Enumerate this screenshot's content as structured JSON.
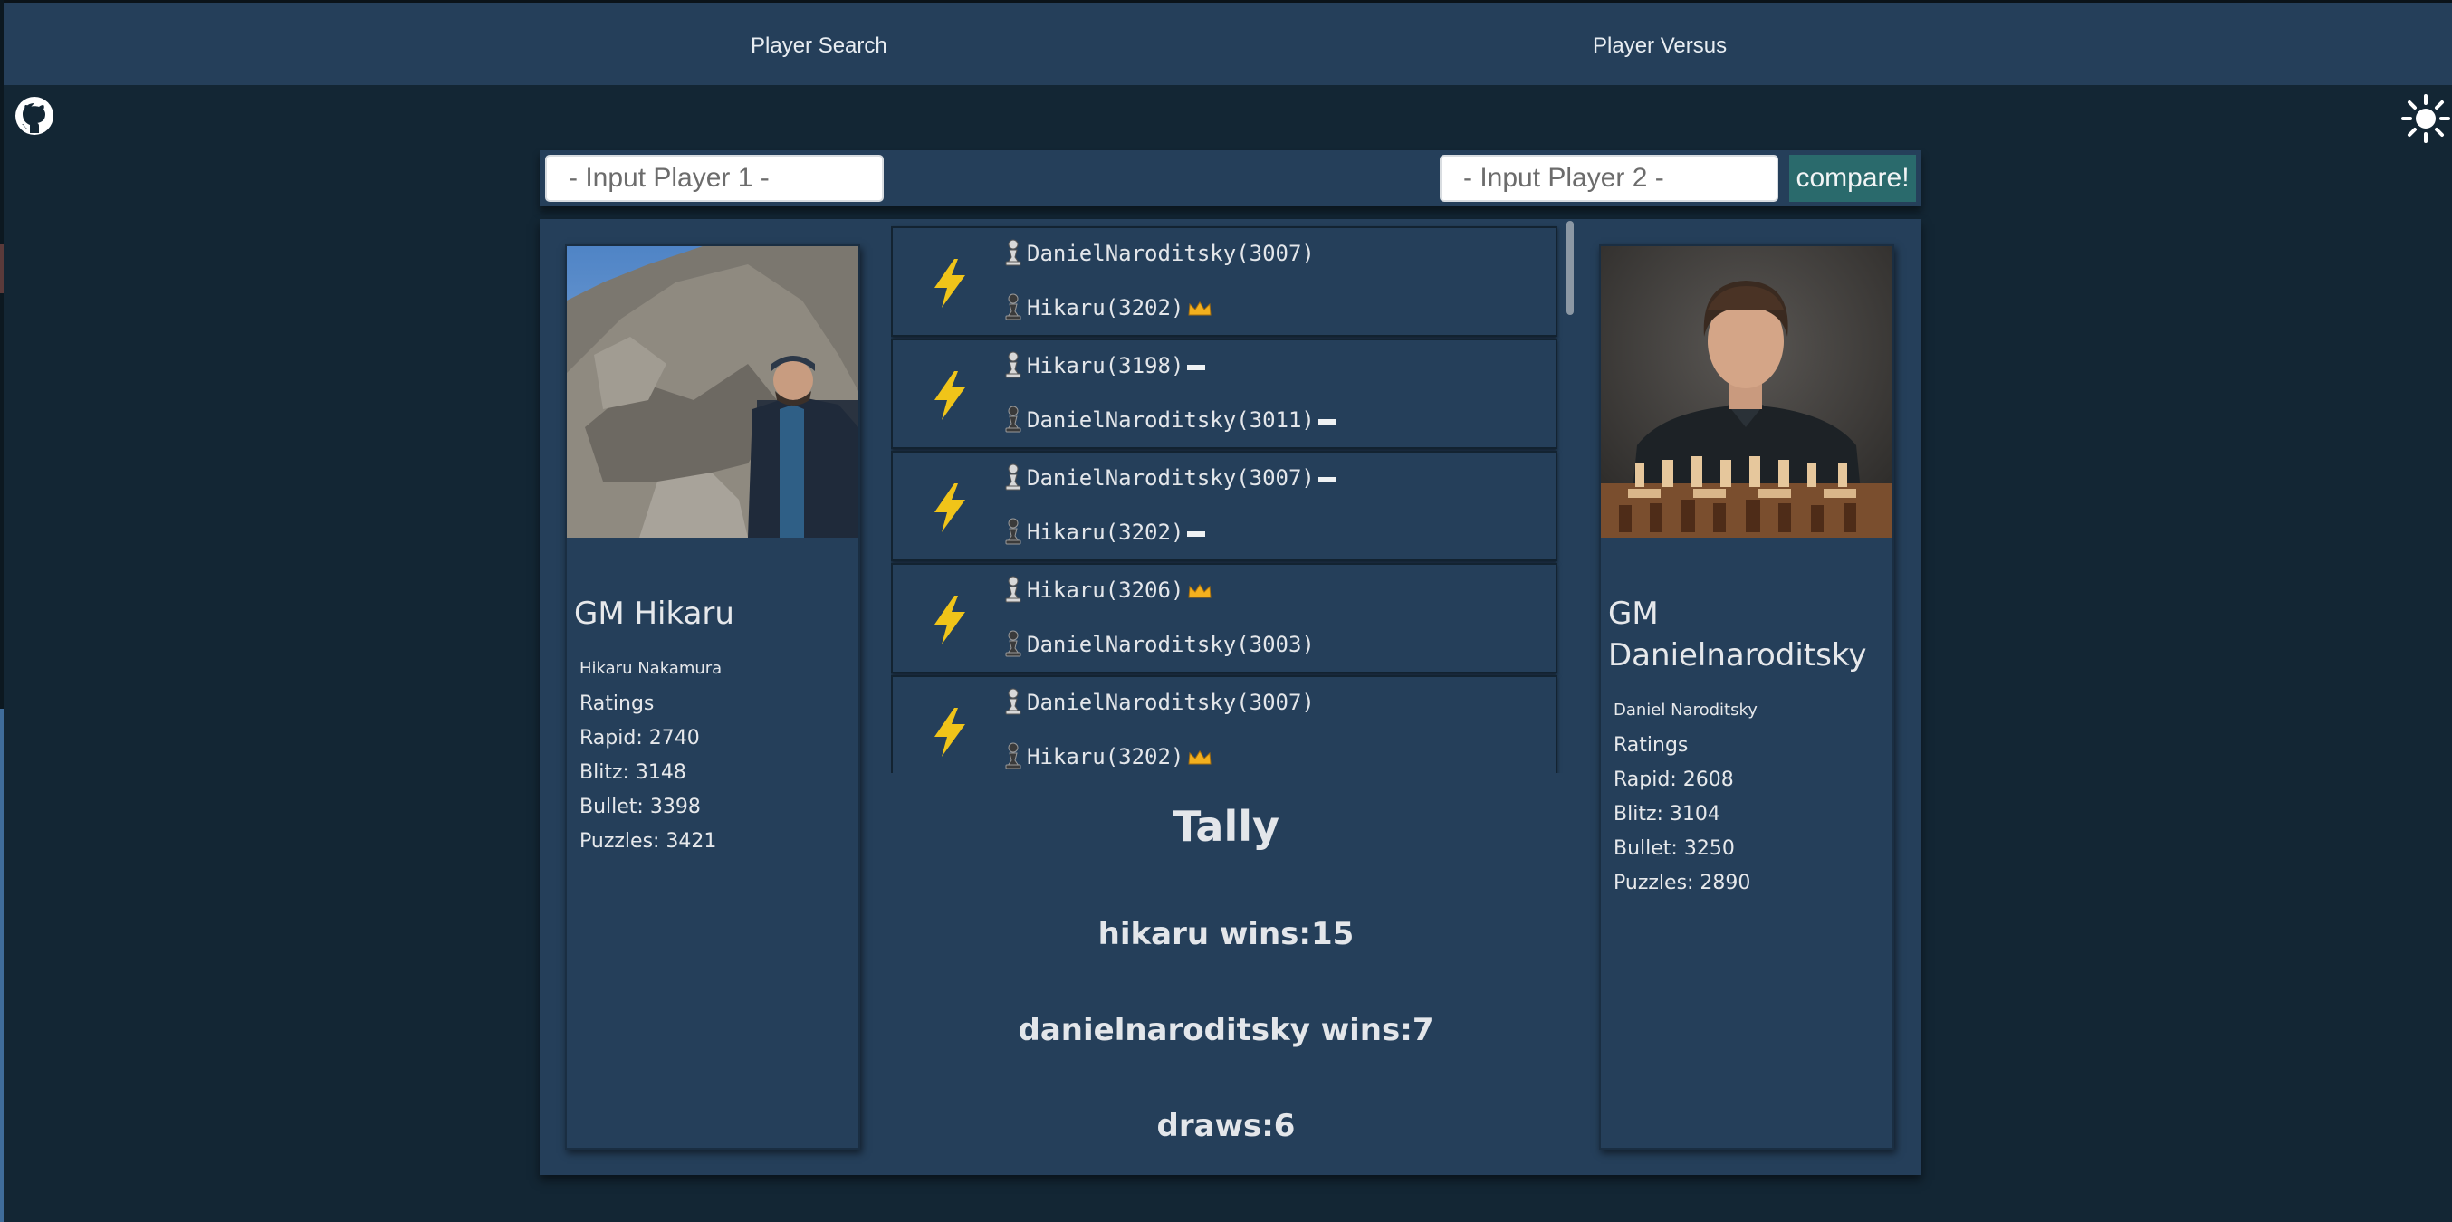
{
  "nav": {
    "player_search": "Player Search",
    "player_versus": "Player Versus"
  },
  "icons": {
    "github": "github-icon",
    "theme_toggle": "sun-icon",
    "game_speed": "lightning-bolt-icon",
    "white_piece": "white-pawn-icon",
    "black_piece": "black-pawn-icon",
    "win_marker": "crown-icon",
    "draw_marker": "draw-dash-icon"
  },
  "compare": {
    "player1_placeholder": "- Input Player 1 -",
    "player1_value": "",
    "player2_placeholder": "- Input Player 2 -",
    "player2_value": "",
    "button_label": "compare!"
  },
  "player1": {
    "title": "GM Hikaru",
    "real_name": "Hikaru Nakamura",
    "ratings_label": "Ratings",
    "rapid": "Rapid: 2740",
    "blitz": "Blitz: 3148",
    "bullet": "Bullet: 3398",
    "puzzles": "Puzzles: 3421"
  },
  "player2": {
    "title": "GM Danielnaroditsky",
    "real_name": "Daniel Naroditsky",
    "ratings_label": "Ratings",
    "rapid": "Rapid: 2608",
    "blitz": "Blitz: 3104",
    "bullet": "Bullet: 3250",
    "puzzles": "Puzzles: 2890"
  },
  "games": [
    {
      "white": "DanielNaroditsky(3007)",
      "white_result": "",
      "black": "Hikaru(3202)",
      "black_result": "win"
    },
    {
      "white": "Hikaru(3198)",
      "white_result": "draw",
      "black": "DanielNaroditsky(3011)",
      "black_result": "draw"
    },
    {
      "white": "DanielNaroditsky(3007)",
      "white_result": "draw",
      "black": "Hikaru(3202)",
      "black_result": "draw"
    },
    {
      "white": "Hikaru(3206)",
      "white_result": "win",
      "black": "DanielNaroditsky(3003)",
      "black_result": ""
    },
    {
      "white": "DanielNaroditsky(3007)",
      "white_result": "",
      "black": "Hikaru(3202)",
      "black_result": "win"
    }
  ],
  "colors": {
    "background": "#132634",
    "panel": "#253f5a",
    "accent_button": "#2a6a6c",
    "bolt": "#f0c419",
    "crown": "#f2b01e"
  },
  "tally": {
    "title": "Tally",
    "player1_wins": "hikaru wins:15",
    "player2_wins": "danielnaroditsky wins:7",
    "draws": "draws:6"
  }
}
